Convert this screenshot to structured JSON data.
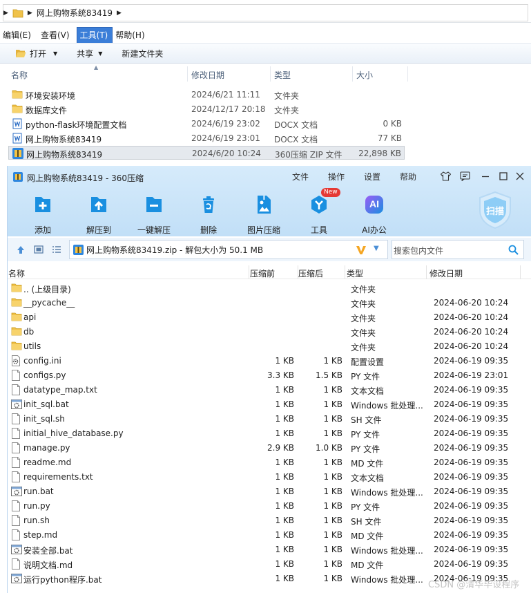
{
  "explorer": {
    "breadcrumb": [
      "网上购物系统83419"
    ],
    "menu": [
      "编辑(E)",
      "查看(V)",
      "工具(T)",
      "帮助(H)"
    ],
    "active_menu_index": 2,
    "commands": {
      "open": "打开",
      "share": "共享",
      "new_folder": "新建文件夹"
    },
    "columns": {
      "name": "名称",
      "date": "修改日期",
      "type": "类型",
      "size": "大小"
    },
    "rows": [
      {
        "name": "环境安装环境",
        "date": "2024/6/21 11:11",
        "type": "文件夹",
        "size": "",
        "icon": "folder-icon"
      },
      {
        "name": "数据库文件",
        "date": "2024/12/17 20:18",
        "type": "文件夹",
        "size": "",
        "icon": "folder-icon"
      },
      {
        "name": "python-flask环境配置文档",
        "date": "2024/6/19 23:02",
        "type": "DOCX 文档",
        "size": "0 KB",
        "icon": "word-doc-icon"
      },
      {
        "name": "网上购物系统83419",
        "date": "2024/6/19 23:01",
        "type": "DOCX 文档",
        "size": "77 KB",
        "icon": "word-doc-icon"
      },
      {
        "name": "网上购物系统83419",
        "date": "2024/6/20 10:24",
        "type": "360压缩 ZIP 文件",
        "size": "22,898 KB",
        "icon": "zip-archive-icon",
        "selected": true
      }
    ]
  },
  "zip": {
    "title": "网上购物系统83419 - 360压缩",
    "menu": [
      "文件",
      "操作",
      "设置",
      "帮助"
    ],
    "toolbar": [
      {
        "label": "添加",
        "icon": "add-icon"
      },
      {
        "label": "解压到",
        "icon": "extract-to-icon"
      },
      {
        "label": "一键解压",
        "icon": "one-click-extract-icon"
      },
      {
        "label": "删除",
        "icon": "delete-icon"
      },
      {
        "label": "图片压缩",
        "icon": "image-compress-icon"
      },
      {
        "label": "工具",
        "icon": "tools-icon"
      },
      {
        "label": "AI办公",
        "icon": "ai-office-icon"
      }
    ],
    "new_badge": "New",
    "ai_icon_text": "AI",
    "scan_label": "扫描",
    "path": "网上购物系统83419.zip - 解包大小为 50.1 MB",
    "search_placeholder": "搜索包内文件",
    "columns": {
      "name": "名称",
      "before": "压缩前",
      "after": "压缩后",
      "type": "类型",
      "date": "修改日期"
    },
    "rows": [
      {
        "name": ".. (上级目录)",
        "before": "",
        "after": "",
        "type": "文件夹",
        "date": "",
        "icon": "folder-icon"
      },
      {
        "name": "__pycache__",
        "before": "",
        "after": "",
        "type": "文件夹",
        "date": "2024-06-20 10:24",
        "icon": "folder-icon"
      },
      {
        "name": "api",
        "before": "",
        "after": "",
        "type": "文件夹",
        "date": "2024-06-20 10:24",
        "icon": "folder-icon"
      },
      {
        "name": "db",
        "before": "",
        "after": "",
        "type": "文件夹",
        "date": "2024-06-20 10:24",
        "icon": "folder-icon"
      },
      {
        "name": "utils",
        "before": "",
        "after": "",
        "type": "文件夹",
        "date": "2024-06-20 10:24",
        "icon": "folder-icon"
      },
      {
        "name": "config.ini",
        "before": "1 KB",
        "after": "1 KB",
        "type": "配置设置",
        "date": "2024-06-19 09:35",
        "icon": "settings-file-icon"
      },
      {
        "name": "configs.py",
        "before": "3.3 KB",
        "after": "1.5 KB",
        "type": "PY 文件",
        "date": "2024-06-19 23:01",
        "icon": "file-icon"
      },
      {
        "name": "datatype_map.txt",
        "before": "1 KB",
        "after": "1 KB",
        "type": "文本文档",
        "date": "2024-06-19 09:35",
        "icon": "file-icon"
      },
      {
        "name": "init_sql.bat",
        "before": "1 KB",
        "after": "1 KB",
        "type": "Windows 批处理...",
        "date": "2024-06-19 09:35",
        "icon": "batch-file-icon"
      },
      {
        "name": "init_sql.sh",
        "before": "1 KB",
        "after": "1 KB",
        "type": "SH 文件",
        "date": "2024-06-19 09:35",
        "icon": "file-icon"
      },
      {
        "name": "initial_hive_database.py",
        "before": "1 KB",
        "after": "1 KB",
        "type": "PY 文件",
        "date": "2024-06-19 09:35",
        "icon": "file-icon"
      },
      {
        "name": "manage.py",
        "before": "2.9 KB",
        "after": "1.0 KB",
        "type": "PY 文件",
        "date": "2024-06-19 09:35",
        "icon": "file-icon"
      },
      {
        "name": "readme.md",
        "before": "1 KB",
        "after": "1 KB",
        "type": "MD 文件",
        "date": "2024-06-19 09:35",
        "icon": "file-icon"
      },
      {
        "name": "requirements.txt",
        "before": "1 KB",
        "after": "1 KB",
        "type": "文本文档",
        "date": "2024-06-19 09:35",
        "icon": "file-icon"
      },
      {
        "name": "run.bat",
        "before": "1 KB",
        "after": "1 KB",
        "type": "Windows 批处理...",
        "date": "2024-06-19 09:35",
        "icon": "batch-file-icon"
      },
      {
        "name": "run.py",
        "before": "1 KB",
        "after": "1 KB",
        "type": "PY 文件",
        "date": "2024-06-19 09:35",
        "icon": "file-icon"
      },
      {
        "name": "run.sh",
        "before": "1 KB",
        "after": "1 KB",
        "type": "SH 文件",
        "date": "2024-06-19 09:35",
        "icon": "file-icon"
      },
      {
        "name": "step.md",
        "before": "1 KB",
        "after": "1 KB",
        "type": "MD 文件",
        "date": "2024-06-19 09:35",
        "icon": "file-icon"
      },
      {
        "name": "安装全部.bat",
        "before": "1 KB",
        "after": "1 KB",
        "type": "Windows 批处理...",
        "date": "2024-06-19 09:35",
        "icon": "batch-file-icon"
      },
      {
        "name": "说明文档.md",
        "before": "1 KB",
        "after": "1 KB",
        "type": "MD 文件",
        "date": "2024-06-19 09:35",
        "icon": "file-icon"
      },
      {
        "name": "运行python程序.bat",
        "before": "1 KB",
        "after": "1 KB",
        "type": "Windows 批处理...",
        "date": "2024-06-19 09:35",
        "icon": "batch-file-icon"
      }
    ]
  },
  "watermark": "CSDN @清华毕设程序",
  "colors": {
    "accent": "#1a8fe0",
    "menu_active": "#3b7ed8",
    "folder": "#f0c24a",
    "title_bg": "#cfe6fa"
  }
}
